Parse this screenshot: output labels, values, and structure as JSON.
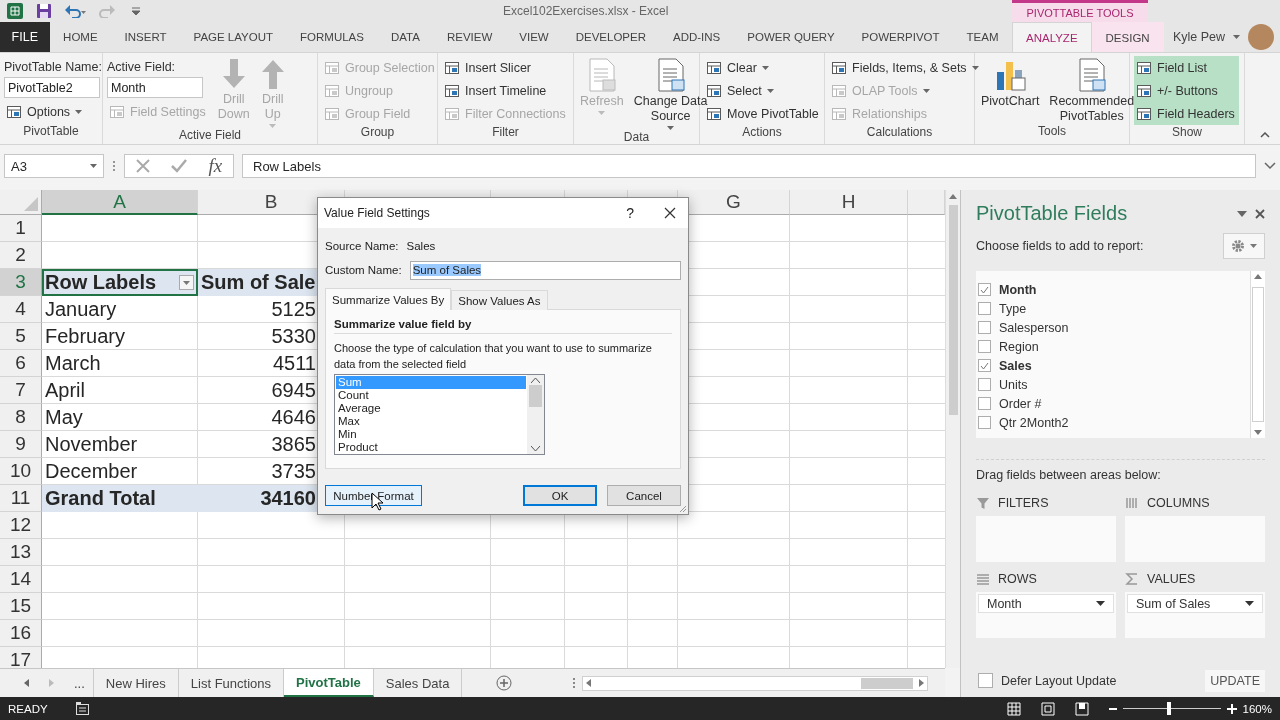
{
  "title_bar": {
    "title": "Excel102Exercises.xlsx - Excel",
    "context_header": "PIVOTTABLE TOOLS"
  },
  "menu_tabs": [
    {
      "label": "FILE",
      "kind": "file",
      "selected": false
    },
    {
      "label": "HOME",
      "kind": "tab",
      "selected": false
    },
    {
      "label": "INSERT",
      "kind": "tab",
      "selected": false
    },
    {
      "label": "PAGE LAYOUT",
      "kind": "tab",
      "selected": false
    },
    {
      "label": "FORMULAS",
      "kind": "tab",
      "selected": false
    },
    {
      "label": "DATA",
      "kind": "tab",
      "selected": false
    },
    {
      "label": "REVIEW",
      "kind": "tab",
      "selected": false
    },
    {
      "label": "VIEW",
      "kind": "tab",
      "selected": false
    },
    {
      "label": "DEVELOPER",
      "kind": "tab",
      "selected": false
    },
    {
      "label": "ADD-INS",
      "kind": "tab",
      "selected": false
    },
    {
      "label": "POWER QUERY",
      "kind": "tab",
      "selected": false
    },
    {
      "label": "POWERPIVOT",
      "kind": "tab",
      "selected": false
    },
    {
      "label": "TEAM",
      "kind": "tab",
      "selected": false
    },
    {
      "label": "ANALYZE",
      "kind": "context",
      "selected": true
    },
    {
      "label": "DESIGN",
      "kind": "context",
      "selected": false
    }
  ],
  "user": {
    "name": "Kyle Pew"
  },
  "ribbon": [
    {
      "label": "PivotTable",
      "columns": [
        [
          {
            "kind": "label",
            "label": "PivotTable Name:"
          },
          {
            "kind": "field",
            "value": "PivotTable2"
          },
          {
            "kind": "small",
            "label": "Options",
            "disabled": false,
            "dropdown": true
          }
        ]
      ]
    },
    {
      "label": "Active Field",
      "columns": [
        [
          {
            "kind": "label",
            "label": "Active Field:"
          },
          {
            "kind": "field",
            "value": "Month"
          },
          {
            "kind": "small",
            "label": "Field Settings",
            "disabled": true,
            "dropdown": false
          }
        ],
        [
          {
            "kind": "drilldown",
            "label": "Drill\nDown",
            "disabled": true,
            "dropdown": false
          }
        ],
        [
          {
            "kind": "drillup",
            "label": "Drill\nUp",
            "disabled": true,
            "dropdown": true
          }
        ]
      ]
    },
    {
      "label": "Group",
      "columns": [
        [
          {
            "kind": "small",
            "label": "Group Selection",
            "disabled": true,
            "dropdown": false
          },
          {
            "kind": "small",
            "label": "Ungroup",
            "disabled": true,
            "dropdown": false
          },
          {
            "kind": "small",
            "label": "Group Field",
            "disabled": true,
            "dropdown": false
          }
        ]
      ]
    },
    {
      "label": "Filter",
      "columns": [
        [
          {
            "kind": "small",
            "label": "Insert Slicer",
            "disabled": false,
            "dropdown": false
          },
          {
            "kind": "small",
            "label": "Insert Timeline",
            "disabled": false,
            "dropdown": false
          },
          {
            "kind": "small",
            "label": "Filter Connections",
            "disabled": true,
            "dropdown": false
          }
        ]
      ]
    },
    {
      "label": "Data",
      "columns": [
        [
          {
            "kind": "large",
            "label": "Refresh",
            "disabled": true,
            "dropdown": true
          }
        ],
        [
          {
            "kind": "large",
            "label": "Change Data\nSource",
            "disabled": false,
            "dropdown": true
          }
        ]
      ]
    },
    {
      "label": "Actions",
      "columns": [
        [
          {
            "kind": "small",
            "label": "Clear",
            "disabled": false,
            "dropdown": true
          },
          {
            "kind": "small",
            "label": "Select",
            "disabled": false,
            "dropdown": true
          },
          {
            "kind": "small",
            "label": "Move PivotTable",
            "disabled": false,
            "dropdown": false
          }
        ]
      ]
    },
    {
      "label": "Calculations",
      "columns": [
        [
          {
            "kind": "small",
            "label": "Fields, Items, & Sets",
            "disabled": false,
            "dropdown": true
          },
          {
            "kind": "small",
            "label": "OLAP Tools",
            "disabled": true,
            "dropdown": true
          },
          {
            "kind": "small",
            "label": "Relationships",
            "disabled": true,
            "dropdown": false
          }
        ]
      ]
    },
    {
      "label": "Tools",
      "columns": [
        [
          {
            "kind": "chart",
            "label": "PivotChart",
            "disabled": false,
            "dropdown": false
          }
        ],
        [
          {
            "kind": "large",
            "label": "Recommended\nPivotTables",
            "disabled": false,
            "dropdown": false
          }
        ]
      ]
    },
    {
      "label": "Show",
      "columns": [
        [
          {
            "kind": "toggle",
            "label": "Field List",
            "on": true
          },
          {
            "kind": "toggle",
            "label": "+/- Buttons",
            "on": true
          },
          {
            "kind": "toggle",
            "label": "Field Headers",
            "on": true
          }
        ]
      ]
    }
  ],
  "formula_bar": {
    "cell": "A3",
    "function_symbol": "fx",
    "formula": "Row Labels"
  },
  "sheet": {
    "columns": [
      {
        "label": "A",
        "selected": true
      },
      {
        "label": "B",
        "selected": false
      },
      {
        "selected": false
      },
      {
        "selected": false
      },
      {
        "selected": false
      },
      {
        "selected": false
      },
      {
        "label": "G",
        "selected": false
      },
      {
        "label": "H",
        "selected": false
      },
      {
        "selected": false
      }
    ],
    "rows": [
      {
        "number": "1",
        "kind": "empty",
        "selected": false
      },
      {
        "number": "2",
        "kind": "empty",
        "selected": false
      },
      {
        "number": "3",
        "kind": "header",
        "selected": true,
        "cells": [
          "Row Labels",
          "Sum of Sale"
        ]
      },
      {
        "number": "4",
        "kind": "item",
        "selected": false,
        "cells": [
          "January",
          "5125"
        ]
      },
      {
        "number": "5",
        "kind": "item",
        "selected": false,
        "cells": [
          "February",
          "5330"
        ]
      },
      {
        "number": "6",
        "kind": "item",
        "selected": false,
        "cells": [
          "March",
          "4511"
        ]
      },
      {
        "number": "7",
        "kind": "item",
        "selected": false,
        "cells": [
          "April",
          "6945"
        ]
      },
      {
        "number": "8",
        "kind": "item",
        "selected": false,
        "cells": [
          "May",
          "4646"
        ]
      },
      {
        "number": "9",
        "kind": "item",
        "selected": false,
        "cells": [
          "November",
          "3865"
        ]
      },
      {
        "number": "10",
        "kind": "item",
        "selected": false,
        "cells": [
          "December",
          "3735"
        ]
      },
      {
        "number": "11",
        "kind": "total",
        "selected": false,
        "cells": [
          "Grand Total",
          "34160"
        ]
      },
      {
        "number": "12",
        "kind": "empty",
        "selected": false
      },
      {
        "number": "13",
        "kind": "empty",
        "selected": false
      },
      {
        "number": "14",
        "kind": "empty",
        "selected": false
      },
      {
        "number": "15",
        "kind": "empty",
        "selected": false
      },
      {
        "number": "16",
        "kind": "empty",
        "selected": false
      },
      {
        "number": "17",
        "kind": "empty",
        "selected": false
      }
    ]
  },
  "sheet_tabs": {
    "more": "...",
    "tabs": [
      {
        "label": "New Hires",
        "selected": false
      },
      {
        "label": "List Functions",
        "selected": false
      },
      {
        "label": "PivotTable",
        "selected": true
      },
      {
        "label": "Sales Data",
        "selected": false
      }
    ]
  },
  "status_bar": {
    "mode": "READY",
    "zoom": "160%",
    "zoom_slider": {
      "level": 0.47
    }
  },
  "task_pane": {
    "title": "PivotTable Fields",
    "prompt": "Choose fields to add to report:",
    "fields": [
      {
        "label": "Month",
        "checked": true
      },
      {
        "label": "Type",
        "checked": false
      },
      {
        "label": "Salesperson",
        "checked": false
      },
      {
        "label": "Region",
        "checked": false
      },
      {
        "label": "Sales",
        "checked": true
      },
      {
        "label": "Units",
        "checked": false
      },
      {
        "label": "Order #",
        "checked": false
      },
      {
        "label": "Qtr 2Month2",
        "checked": false
      }
    ],
    "drag_hint": "Drag fields between areas below:",
    "areas": [
      {
        "kind": "filters",
        "label": "FILTERS"
      },
      {
        "kind": "columns",
        "label": "COLUMNS"
      },
      {
        "kind": "rows",
        "label": "ROWS",
        "items": [
          "Month"
        ]
      },
      {
        "kind": "values",
        "label": "VALUES",
        "items": [
          "Sum of Sales"
        ]
      }
    ],
    "defer": {
      "label": "Defer Layout Update",
      "checked": false
    },
    "update_button": "UPDATE"
  },
  "dialog": {
    "title": "Value Field Settings",
    "help": "?",
    "source_label": "Source Name:",
    "source_value": "Sales",
    "custom_label": "Custom Name:",
    "custom_value": "Sum of Sales",
    "tabs": [
      {
        "label": "Summarize Values By",
        "selected": true
      },
      {
        "label": "Show Values As",
        "selected": false
      }
    ],
    "heading": "Summarize value field by",
    "description": "Choose the type of calculation that you want to use to summarize data from the selected field",
    "functions": [
      {
        "label": "Sum",
        "selected": true
      },
      {
        "label": "Count",
        "selected": false
      },
      {
        "label": "Average",
        "selected": false
      },
      {
        "label": "Max",
        "selected": false
      },
      {
        "label": "Min",
        "selected": false
      },
      {
        "label": "Product",
        "selected": false
      }
    ],
    "buttons": [
      {
        "label": "Number Format",
        "kind": "hovered"
      },
      {
        "label": "OK",
        "kind": "default"
      },
      {
        "label": "Cancel",
        "kind": "normal"
      }
    ]
  }
}
